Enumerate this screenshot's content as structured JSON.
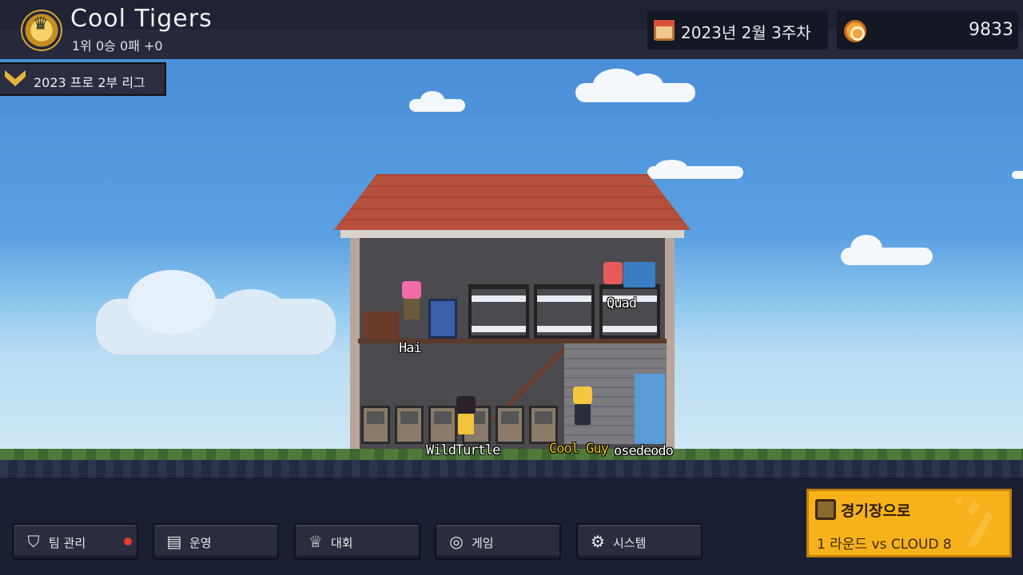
{
  "team": {
    "name": "Cool Tigers",
    "record": "1위 0승 0패 +0"
  },
  "date": "2023년 2월 3주차",
  "coins": "9833",
  "league": "2023 프로 2부 리그",
  "characters": [
    {
      "name": "Hai"
    },
    {
      "name": "Quad"
    },
    {
      "name": "WildTurtle"
    },
    {
      "name": "Cool Guy"
    },
    {
      "name": "osedeodo"
    }
  ],
  "menu": [
    {
      "label": "팀 관리",
      "icon": "shield-icon"
    },
    {
      "label": "운영",
      "icon": "document-icon"
    },
    {
      "label": "대회",
      "icon": "trophy-icon"
    },
    {
      "label": "게임",
      "icon": "gamepad-icon"
    },
    {
      "label": "시스템",
      "icon": "gear-icon"
    }
  ],
  "arena": {
    "title": "경기장으로",
    "subtitle": "1 라운드 vs CLOUD 8"
  },
  "colors": {
    "accent": "#f7b21b",
    "notification": "#e53a2a",
    "highlight_name": "#f2c21a"
  }
}
